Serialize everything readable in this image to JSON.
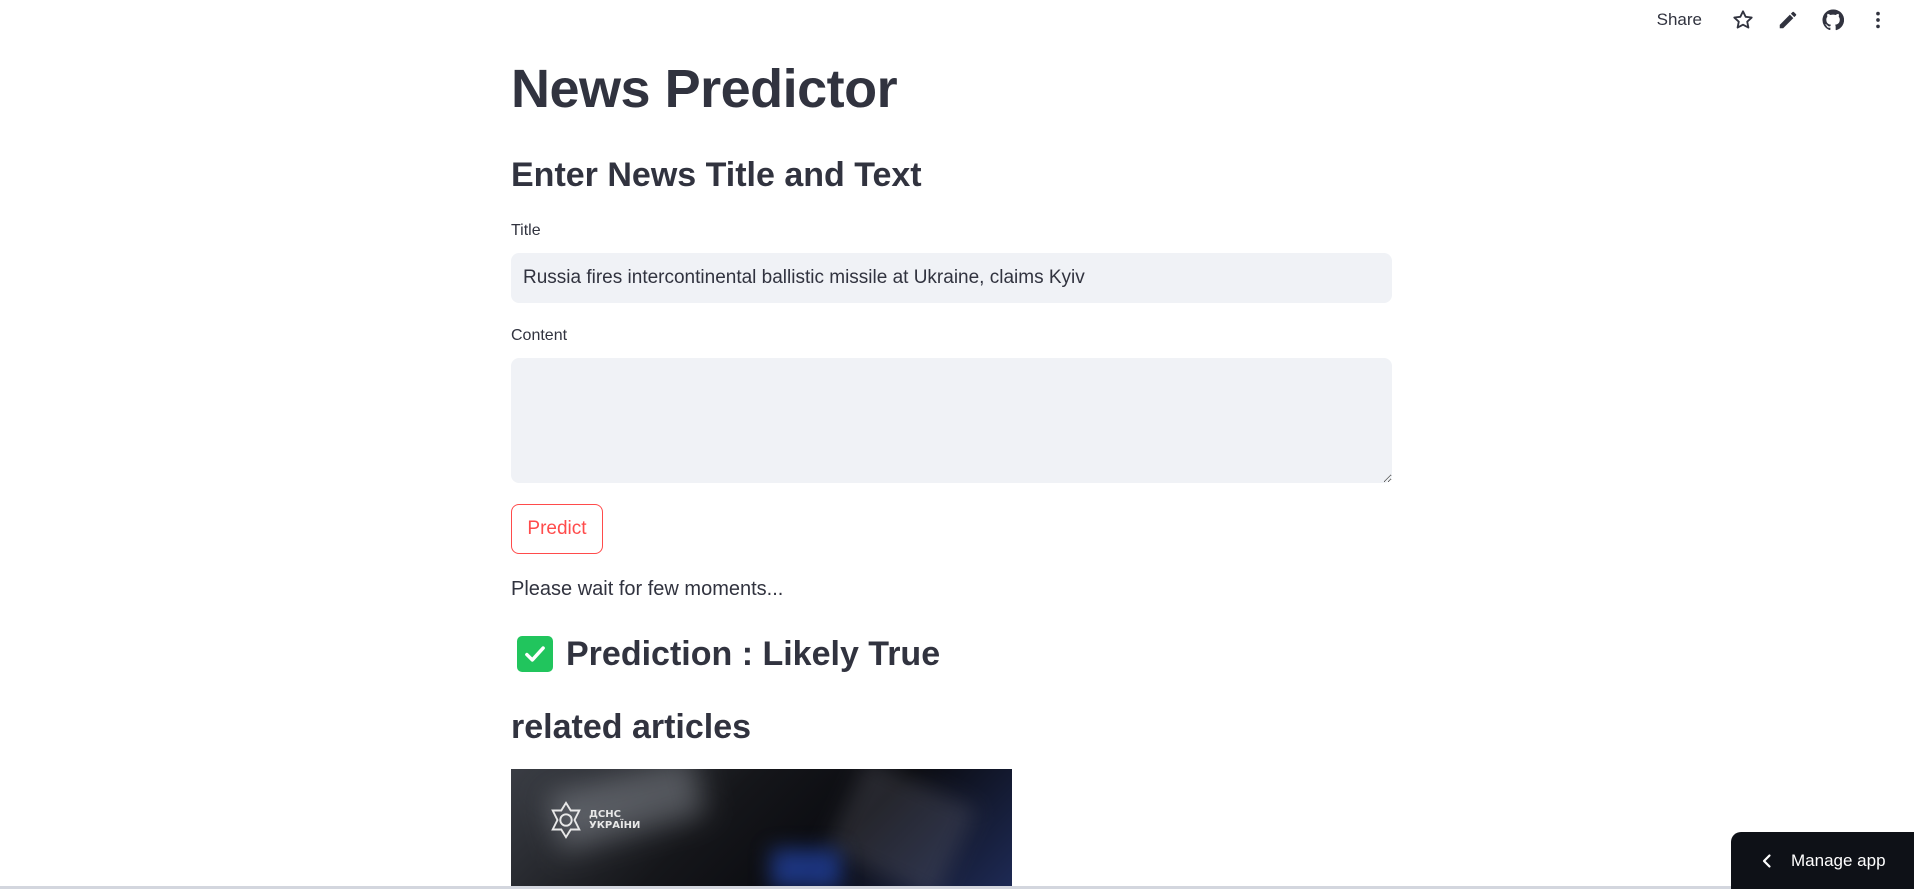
{
  "toolbar": {
    "share_label": "Share",
    "icons": [
      "star-icon",
      "pencil-icon",
      "github-icon",
      "more-vertical-icon"
    ]
  },
  "app": {
    "title": "News Predictor",
    "subheader": "Enter News Title and Text"
  },
  "form": {
    "title_label": "Title",
    "title_value": "Russia fires intercontinental ballistic missile at Ukraine, claims Kyiv",
    "content_label": "Content",
    "content_value": "",
    "predict_label": "Predict"
  },
  "status": {
    "wait_text": "Please wait for few moments..."
  },
  "result": {
    "prediction_text": "Prediction : Likely True",
    "icon": "check-icon",
    "icon_color": "#21c55d"
  },
  "related": {
    "heading": "related articles",
    "image_logo_text": "ДСНС УКРАЇНИ"
  },
  "manage_app": {
    "label": "Manage app"
  },
  "colors": {
    "accent": "#ff4b4b",
    "input_bg": "#f0f2f6",
    "text": "#31333f",
    "manage_bg": "#0e1117"
  }
}
